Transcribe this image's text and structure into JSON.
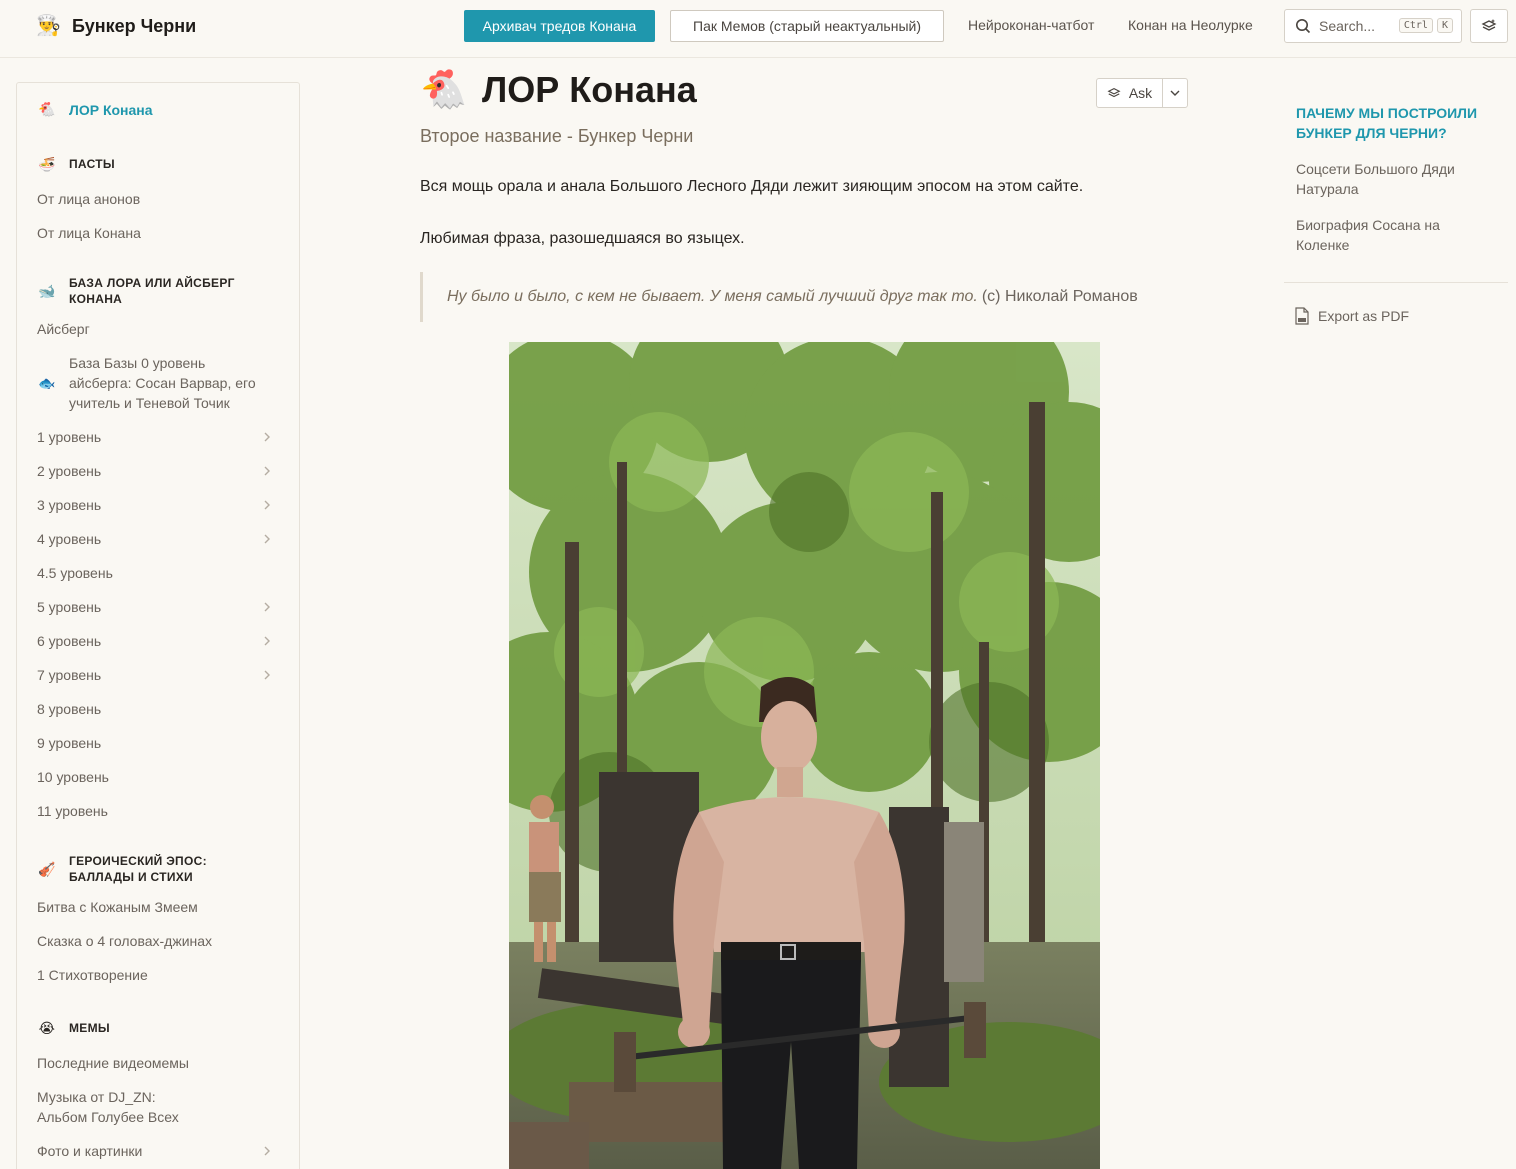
{
  "header": {
    "logo_text": "Бункер Черни",
    "logo_icon": "chef-emoji",
    "primary_button": "Архивач тредов Конана",
    "outline_button": "Пак Мемов (старый неактуальный)",
    "nav_links": [
      "Нейроконан-чатбот",
      "Конан на Неолурке"
    ],
    "search": {
      "placeholder": "Search...",
      "shortcut_mod": "Ctrl",
      "shortcut_key": "K"
    },
    "accent_color": "#1f97ad"
  },
  "sidebar": {
    "active": {
      "emoji": "🐔",
      "label": "ЛОР Конана"
    },
    "sections": [
      {
        "emoji": "🍜",
        "title": "ПАСТЫ",
        "items": [
          "От лица анонов",
          "От лица Конана"
        ]
      },
      {
        "emoji": "🐋",
        "title_line1": "БАЗА ЛОРА ИЛИ АЙСБЕРГ",
        "title_line2": "КОНАНА",
        "items": [
          {
            "label": "Айсберг"
          },
          {
            "emoji": "🐟",
            "line1": "База Базы 0 уровень",
            "line2": "айсберга: Сосан Варвар, его",
            "line3": "учитель и Теневой Точик"
          },
          {
            "label": "1 уровень",
            "chevron": true
          },
          {
            "label": "2 уровень",
            "chevron": true
          },
          {
            "label": "3 уровень",
            "chevron": true
          },
          {
            "label": "4 уровень",
            "chevron": true
          },
          {
            "label": "4.5 уровень"
          },
          {
            "label": "5 уровень",
            "chevron": true
          },
          {
            "label": "6 уровень",
            "chevron": true
          },
          {
            "label": "7 уровень",
            "chevron": true
          },
          {
            "label": "8 уровень"
          },
          {
            "label": "9 уровень"
          },
          {
            "label": "10 уровень"
          },
          {
            "label": "11 уровень"
          }
        ]
      },
      {
        "emoji": "🎻",
        "title_line1": "ГЕРОИЧЕСКИЙ ЭПОС:",
        "title_line2": "БАЛЛАДЫ И СТИХИ",
        "items": [
          "Битва с Кожаным Змеем",
          "Сказка о 4 головах-джинах",
          "1 Стихотворение"
        ]
      },
      {
        "emoji": "😭",
        "title": "МЕМЫ",
        "items": [
          {
            "label": "Последние видеомемы"
          },
          {
            "line1": "Музыка от DJ_ZN:",
            "line2": "Альбом Голубее Всех"
          },
          {
            "label": "Фото и картинки",
            "chevron": true
          }
        ]
      }
    ]
  },
  "main": {
    "title_emoji": "🐔",
    "title": "ЛОР Конана",
    "ask_label": "Ask",
    "subtitle": "Второе название - Бункер Черни",
    "paragraph1": "Вся мощь орала и анала Большого Лесного Дяди лежит зияющим эпосом на этом сайте.",
    "paragraph2": "Любимая фраза, разошедшаяся во языцех.",
    "quote_text": "Ну было и было, с кем не бывает. У меня самый лучший друг так то.",
    "quote_attribution": "(с) Николай Романов"
  },
  "toc": {
    "heading_line1": "ПАЧЕМУ МЫ ПОСТРОИЛИ",
    "heading_line2": "БУНКЕР ДЛЯ ЧЕРНИ?",
    "items": [
      {
        "line1": "Соцсети Большого Дяди",
        "line2": "Натурала"
      },
      {
        "line1": "Биография Сосана на",
        "line2": "Коленке"
      }
    ],
    "export_label": "Export as PDF"
  }
}
